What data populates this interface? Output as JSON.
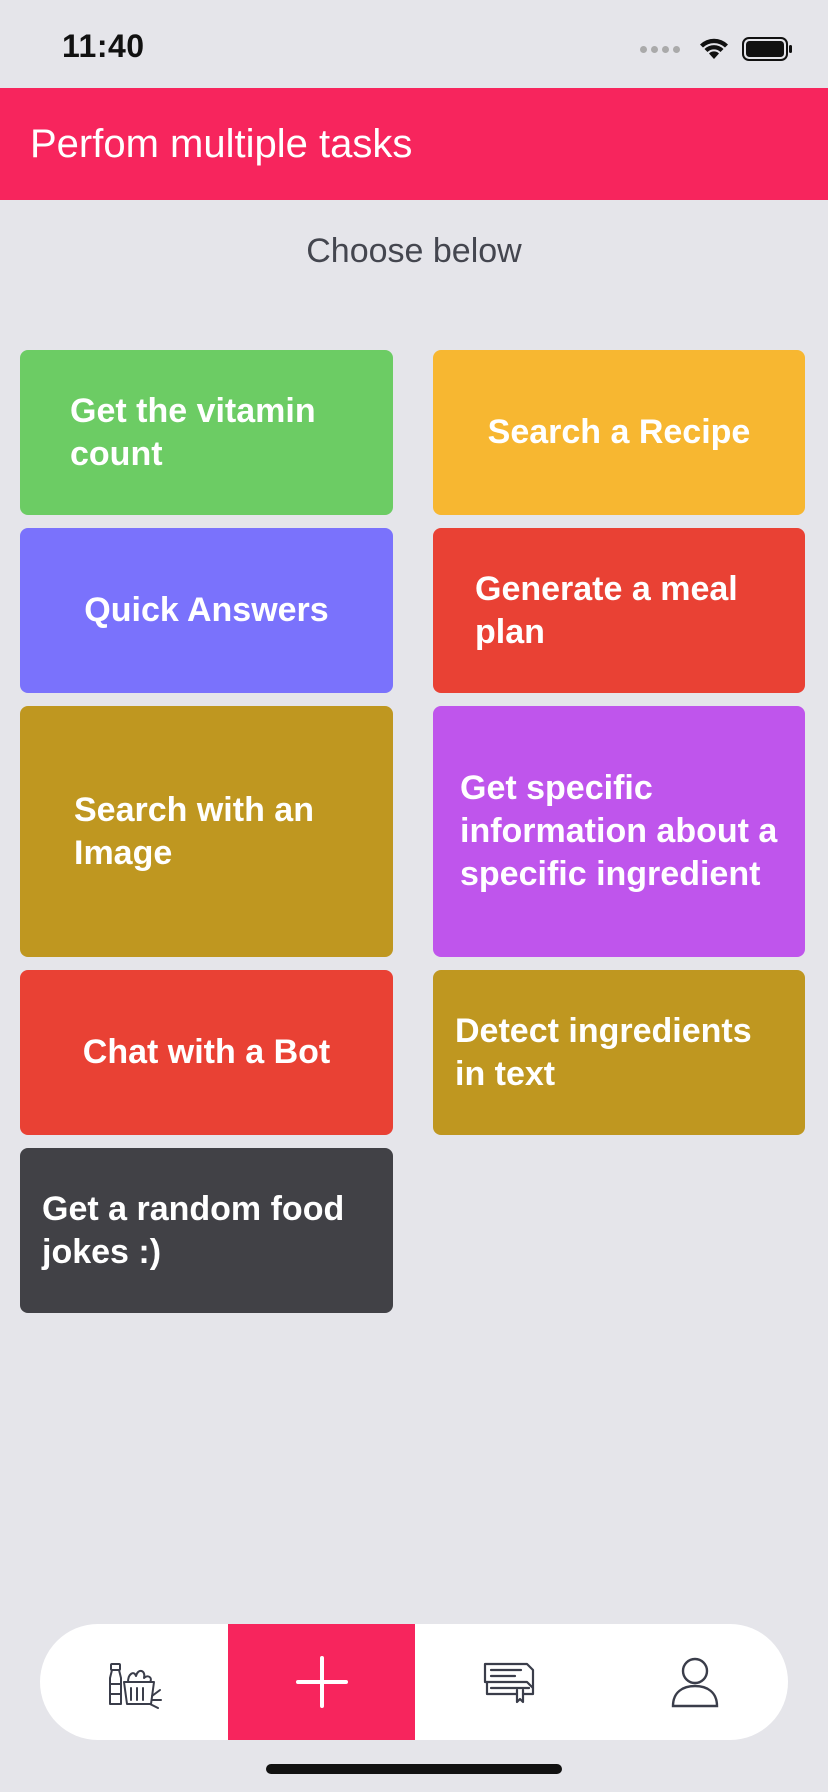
{
  "status_bar": {
    "time": "11:40"
  },
  "header": {
    "title": "Perfom multiple tasks"
  },
  "subtitle": "Choose below",
  "tiles": [
    {
      "label": "Get the vitamin count",
      "color": "#6ccc64"
    },
    {
      "label": "Search a Recipe",
      "color": "#f7b731"
    },
    {
      "label": "Quick Answers",
      "color": "#7a72fc"
    },
    {
      "label": "Generate a meal plan",
      "color": "#e94134"
    },
    {
      "label": "Search with an Image",
      "color": "#bf9720"
    },
    {
      "label": "Get specific information about a specific ingredient",
      "color": "#bf55ec"
    },
    {
      "label": "Chat with a Bot",
      "color": "#e94134"
    },
    {
      "label": "Detect ingredients in text",
      "color": "#bf9720"
    },
    {
      "label": "Get a random food jokes :)",
      "color": "#414146"
    }
  ],
  "tab_bar": {
    "tabs": [
      {
        "icon": "groceries-icon"
      },
      {
        "icon": "plus-icon",
        "active": true
      },
      {
        "icon": "recipe-book-icon"
      },
      {
        "icon": "profile-icon"
      }
    ],
    "active_color": "#f7255d"
  },
  "colors": {
    "accent": "#f7255d",
    "background": "#e5e5ea"
  }
}
